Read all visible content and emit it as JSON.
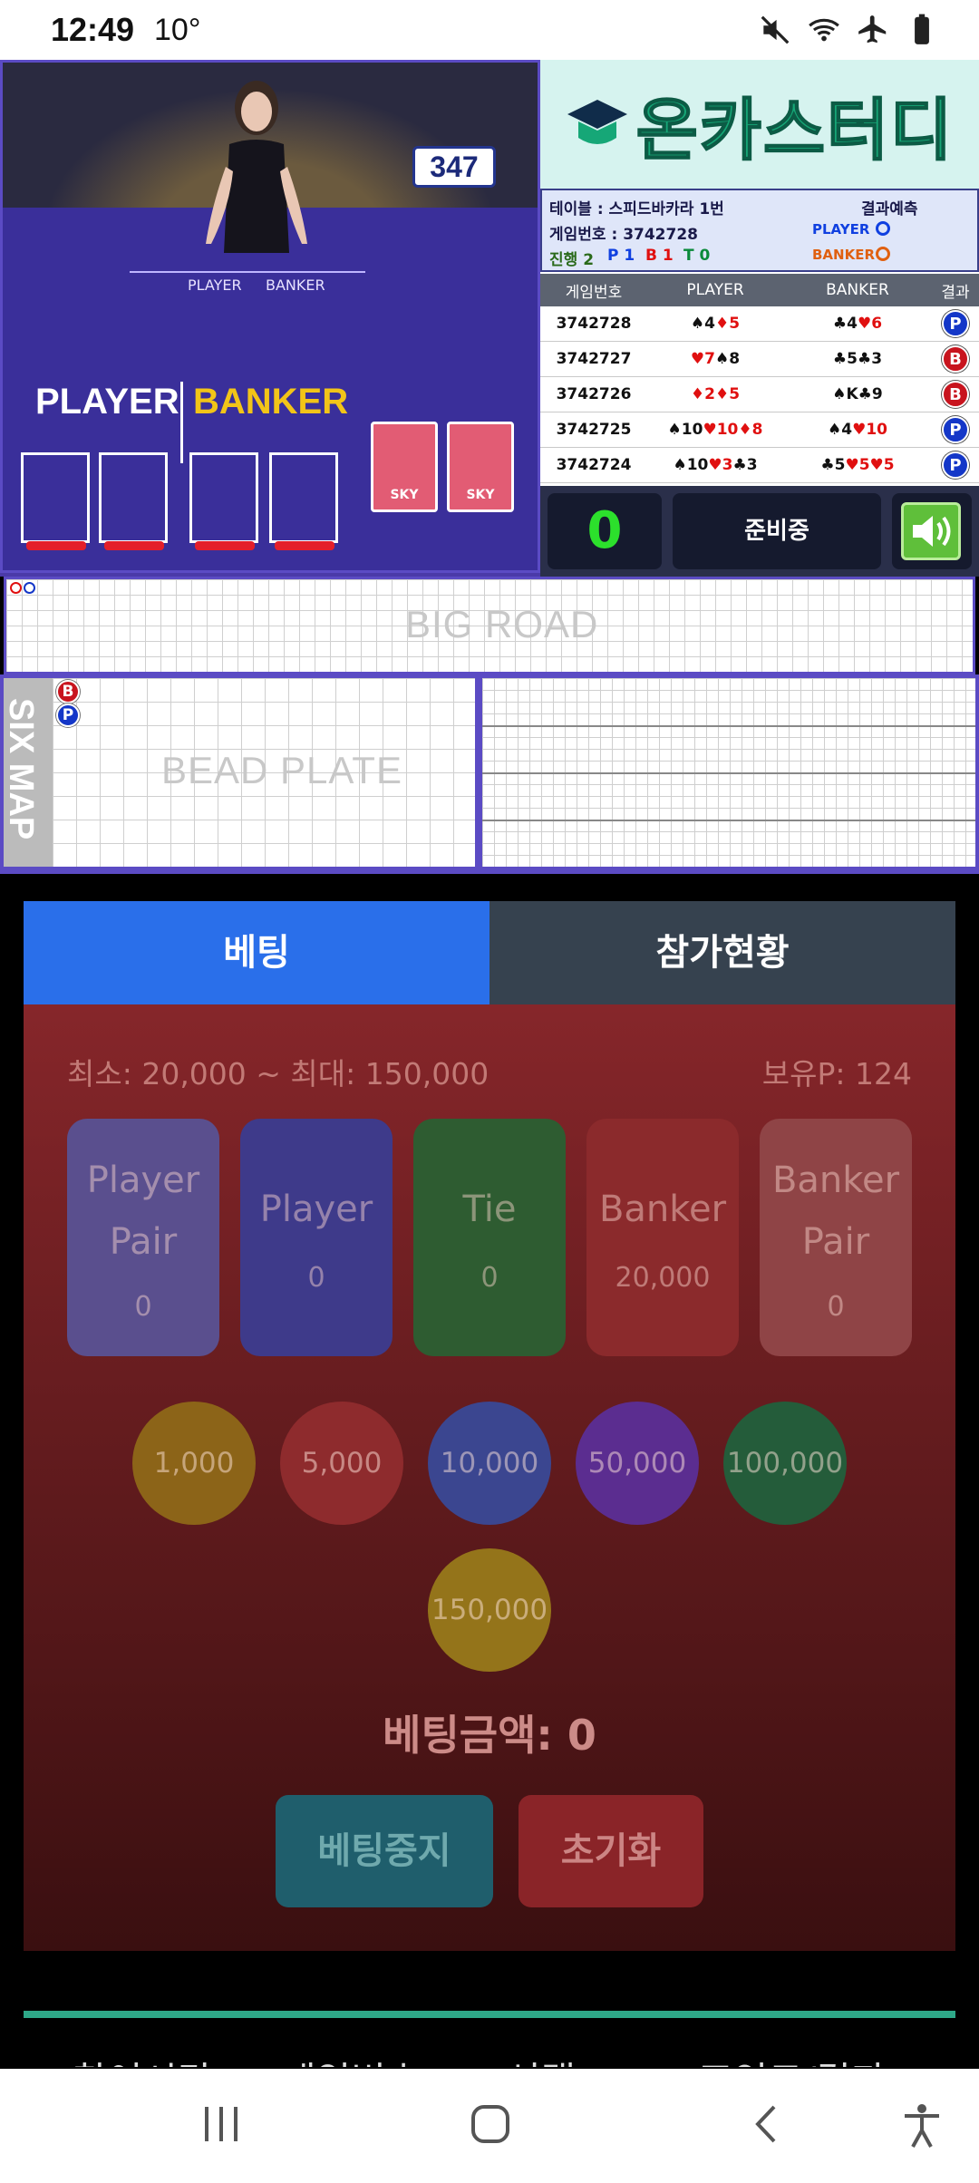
{
  "status_bar": {
    "time": "12:49",
    "temp": "10°"
  },
  "video": {
    "counter": "347",
    "table_player": "PLAYER",
    "table_banker": "BANKER",
    "big_player": "PLAYER",
    "big_banker": "BANKER",
    "card_label": "SKY"
  },
  "logo": {
    "text": "온카스터디"
  },
  "info": {
    "table": "테이블 : 스피드바카라 1번",
    "predict_title": "결과예측",
    "game_no": "게임번호 : 3742728",
    "progress_label": "진행",
    "progress_count": "2",
    "p_count": "P 1",
    "b_count": "B 1",
    "t_count": "T 0",
    "player_label": "PLAYER",
    "banker_label": "BANKER",
    "player_color": "#1040e0",
    "banker_color": "#e06010"
  },
  "history": {
    "headers": [
      "게임번호",
      "PLAYER",
      "BANKER",
      "결과"
    ],
    "rows": [
      {
        "game": "3742728",
        "player": "♠4♦5",
        "banker": "♣4♥6",
        "result": "P"
      },
      {
        "game": "3742727",
        "player": "♥7♠8",
        "banker": "♣5♣3",
        "result": "B"
      },
      {
        "game": "3742726",
        "player": "♦2♦5",
        "banker": "♠K♣9",
        "result": "B"
      },
      {
        "game": "3742725",
        "player": "♠10♥10♦8",
        "banker": "♠4♥10",
        "result": "P"
      },
      {
        "game": "3742724",
        "player": "♠10♥3♣3",
        "banker": "♣5♥5♥5",
        "result": "P"
      }
    ]
  },
  "controls": {
    "count": "0",
    "status": "준비중",
    "sound_icon": "speaker-icon"
  },
  "roads": {
    "big_road": "BIG ROAD",
    "six_map": "SIX MAP",
    "bead_plate": "BEAD PLATE",
    "bead": [
      "B",
      "P"
    ]
  },
  "tabs": {
    "bet": "베팅",
    "status": "참가현황"
  },
  "bet": {
    "limits": "최소: 20,000 ~ 최대: 150,000",
    "points": "보유P: 124",
    "buttons": [
      {
        "line1": "Player",
        "line2": "Pair",
        "value": "0",
        "color": "#5a4f8e"
      },
      {
        "line1": "Player",
        "value": "0",
        "color": "#3e3a8a"
      },
      {
        "line1": "Tie",
        "value": "0",
        "color": "#2e5c31"
      },
      {
        "line1": "Banker",
        "value": "20,000",
        "color": "#8b2a2c"
      },
      {
        "line1": "Banker",
        "line2": "Pair",
        "value": "0",
        "color": "#8f4446"
      }
    ],
    "chips": [
      {
        "label": "1,000",
        "color": "#8c6418"
      },
      {
        "label": "5,000",
        "color": "#8e2b2d"
      },
      {
        "label": "10,000",
        "color": "#3b4690"
      },
      {
        "label": "50,000",
        "color": "#5b2d90"
      },
      {
        "label": "100,000",
        "color": "#245c3a"
      },
      {
        "label": "150,000",
        "color": "#94741a"
      }
    ],
    "amount": "베팅금액: 0",
    "stop": "베팅중지",
    "reset": "초기화"
  },
  "footer_headers": [
    "참여시간",
    "게임번호",
    "선택",
    "포인트/결과"
  ]
}
